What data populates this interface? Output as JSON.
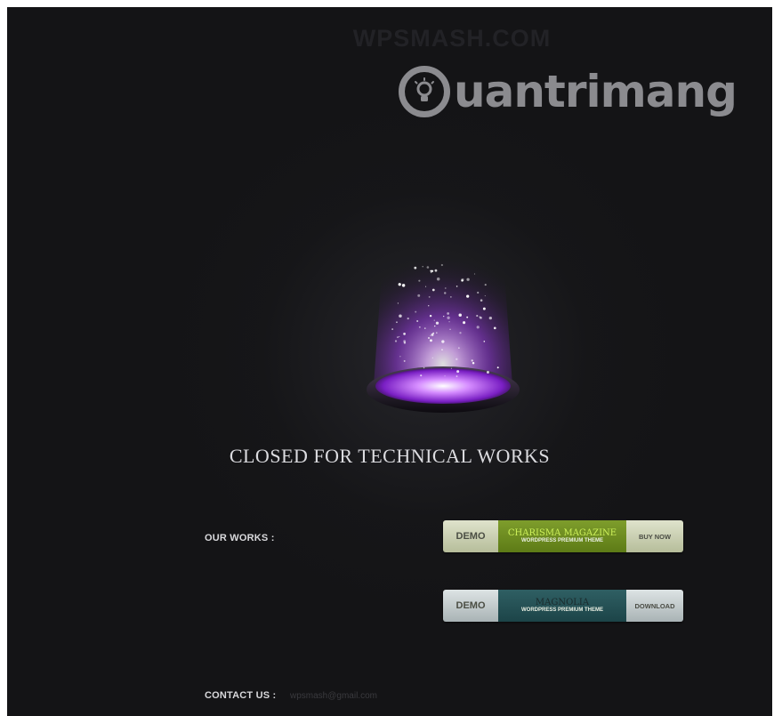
{
  "site_title": "WPSMASH.COM",
  "watermark": {
    "text": "uantrimang",
    "icon": "lightbulb-icon"
  },
  "message": "CLOSED FOR TECHNICAL WORKS",
  "works": {
    "label": "OUR WORKS :",
    "items": [
      {
        "demo_label": "DEMO",
        "name": "CHARISMA MAGAZINE",
        "subtitle": "WORDPRESS PREMIUM THEME",
        "action_label": "BUY NOW",
        "accent_color": "#6b8a1f"
      },
      {
        "demo_label": "DEMO",
        "name": "MAGNOLIA",
        "subtitle": "WORDPRESS PREMIUM  THEME",
        "action_label": "DOWNLOAD",
        "accent_color": "#24514f"
      }
    ]
  },
  "contact": {
    "label": "CONTACT US :",
    "email": "wpsmash@gmail.com"
  },
  "colors": {
    "background": "#141416",
    "glow": "#b04cff"
  }
}
